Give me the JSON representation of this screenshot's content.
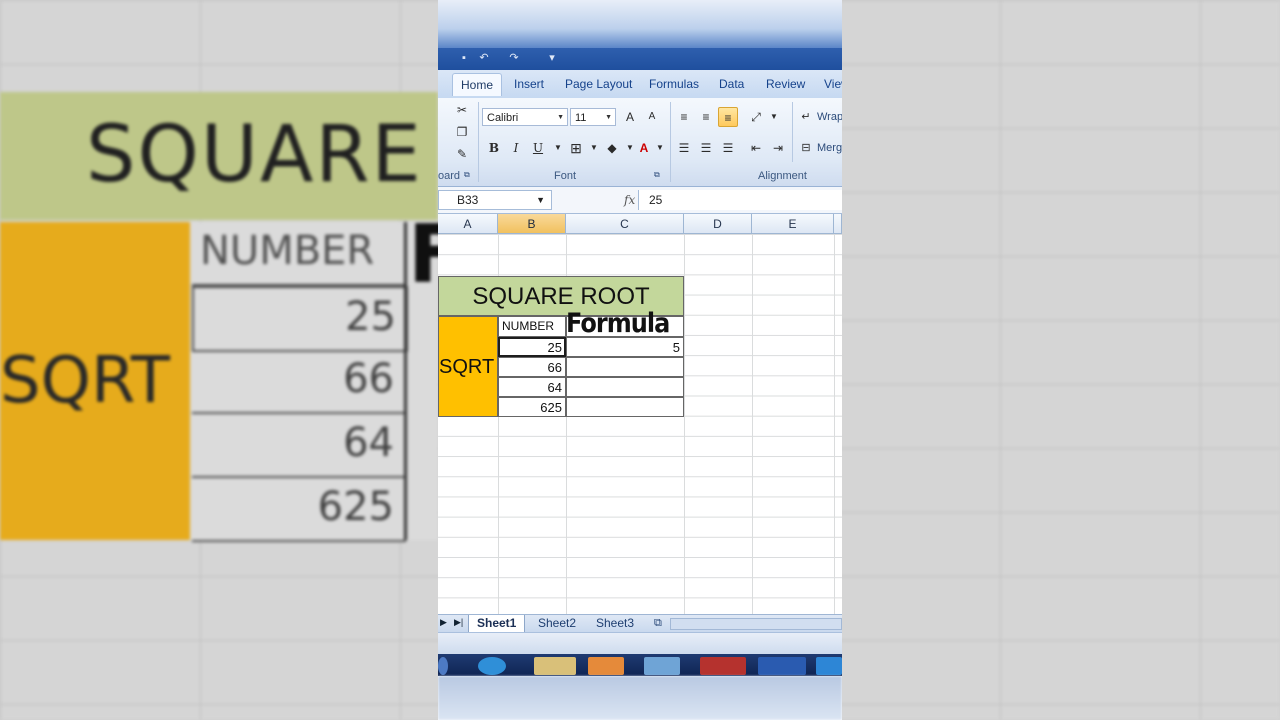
{
  "background": {
    "title": "SQUARE",
    "label": "SQRT",
    "header": "NUMBER",
    "values": [
      "25",
      "66",
      "64",
      "625"
    ],
    "partial": "F"
  },
  "ribbon": {
    "tabs": [
      "Home",
      "Insert",
      "Page Layout",
      "Formulas",
      "Data",
      "Review",
      "View"
    ],
    "active_tab": "Home",
    "font_name": "Calibri",
    "font_size": "11",
    "bold": "B",
    "italic": "I",
    "underline": "U",
    "grow_font": "A",
    "shrink_font": "A",
    "font_color": "A",
    "wrap_text": "Wrap",
    "merge": "Merg",
    "group_clipboard": "oard",
    "group_font": "Font",
    "group_alignment": "Alignment"
  },
  "formula_bar": {
    "name_box": "B33",
    "fx": "fx",
    "value": "25"
  },
  "columns": [
    "A",
    "B",
    "C",
    "D",
    "E"
  ],
  "selected_column": "B",
  "table": {
    "title": "SQUARE ROOT",
    "label": "SQRT",
    "header_number": "NUMBER",
    "header_formula": "Formula",
    "numbers": [
      "25",
      "66",
      "64",
      "625"
    ],
    "results": [
      "5",
      "",
      "",
      ""
    ]
  },
  "sheets": [
    "Sheet1",
    "Sheet2",
    "Sheet3"
  ],
  "active_sheet": "Sheet1",
  "colors": {
    "title_fill": "#c3d79b",
    "label_fill": "#ffc000",
    "selected_header": "#f1c15f",
    "ribbon_blue": "#1f4f9e"
  }
}
